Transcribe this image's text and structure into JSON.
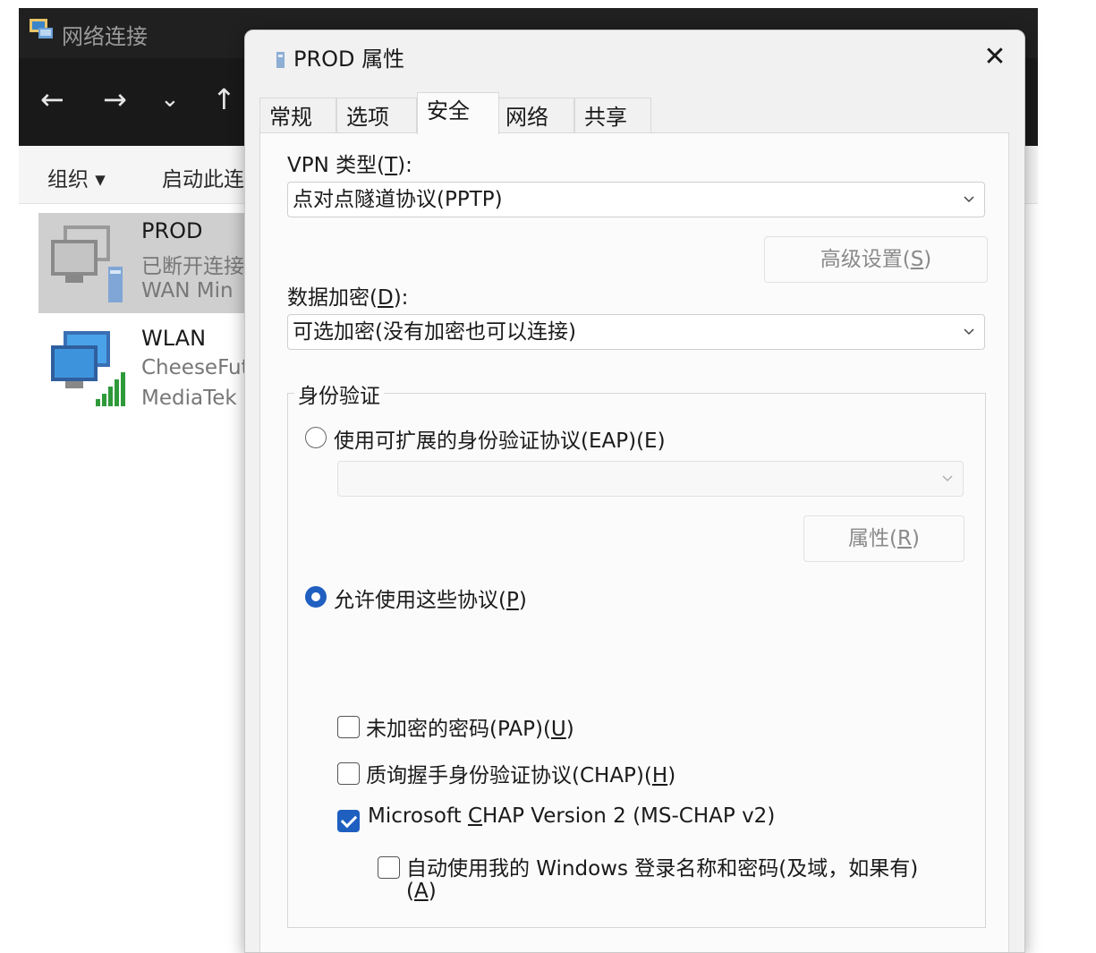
{
  "explorer": {
    "title": "网络连接",
    "nav": {
      "back": "←",
      "forward": "→",
      "recent": "⌄",
      "up": "↑"
    },
    "command_bar": {
      "organize": "组织 ▾",
      "start_connection": "启动此连"
    },
    "items": [
      {
        "name": "PROD",
        "line1": "已断开连接",
        "line2": "WAN Min"
      },
      {
        "name": "WLAN",
        "line1": "CheeseFut",
        "line2": "MediaTek"
      }
    ]
  },
  "dialog": {
    "title": "PROD 属性",
    "close": "✕",
    "tabs": [
      {
        "label": "常规"
      },
      {
        "label": "选项"
      },
      {
        "label": "安全"
      },
      {
        "label": "网络"
      },
      {
        "label": "共享"
      }
    ],
    "active_tab": "安全",
    "vpn_type": {
      "label": "VPN 类型(",
      "mnemonic": "T",
      "label_end": "):",
      "value": "点对点隧道协议(PPTP)"
    },
    "advanced_button": {
      "label": "高级设置(",
      "mnemonic": "S",
      "label_end": ")"
    },
    "encryption": {
      "label": "数据加密(",
      "mnemonic": "D",
      "label_end": "):",
      "value": "可选加密(没有加密也可以连接)"
    },
    "auth": {
      "group_title": "身份验证",
      "eap_radio": {
        "label": "使用可扩展的身份验证协议(EAP)(E)",
        "checked": false
      },
      "eap_combo_value": "",
      "properties_button": {
        "label": "属性(",
        "mnemonic": "R",
        "label_end": ")"
      },
      "protocols_radio": {
        "label": "允许使用这些协议(",
        "mnemonic": "P",
        "label_end": ")",
        "checked": true
      },
      "checkboxes": [
        {
          "label": "未加密的密码(PAP)(",
          "mnemonic": "U",
          "label_end": ")",
          "checked": false
        },
        {
          "label": "质询握手身份验证协议(CHAP)(",
          "mnemonic": "H",
          "label_end": ")",
          "checked": false
        },
        {
          "label": "Microsoft ",
          "mnemonic": "C",
          "label_end": "HAP Version 2 (MS-CHAP v2)",
          "checked": true
        }
      ],
      "auto_logon": {
        "label": "自动使用我的 Windows 登录名称和密码(及域，如果有)",
        "line2_open": "(",
        "mnemonic": "A",
        "line2_close": ")",
        "checked": false
      }
    }
  }
}
